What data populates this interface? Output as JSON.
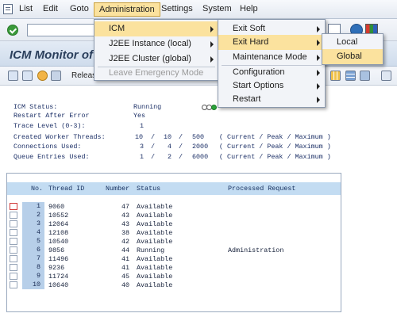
{
  "menubar": {
    "items": [
      "List",
      "Edit",
      "Goto",
      "Administration",
      "Settings",
      "System",
      "Help"
    ]
  },
  "page": {
    "title": "ICM Monitor of"
  },
  "app_toolbar": {
    "release_label": "Releas"
  },
  "status": {
    "icm_status_label": "ICM Status:",
    "icm_status_value": "Running",
    "restart_label": "Restart After Error",
    "restart_value": "Yes",
    "trace_label": "Trace Level (0-3):",
    "trace_value": "1",
    "worker_label": "Created Worker Threads:",
    "worker_current": "10",
    "worker_peak": "10",
    "worker_max": "500",
    "connections_label": "Connections Used:",
    "connections_current": "3",
    "connections_peak": "4",
    "connections_max": "2000",
    "queue_label": "Queue Entries Used:",
    "queue_current": "1",
    "queue_peak": "2",
    "queue_max": "6000",
    "legend": "( Current / Peak / Maximum )",
    "light_color": "#2aa33a"
  },
  "table": {
    "headers": {
      "no": "No.",
      "thread_id": "Thread ID",
      "number": "Number",
      "status": "Status",
      "processed": "Processed Request"
    },
    "rows": [
      {
        "no": "1",
        "thread_id": "9060",
        "number": "47",
        "status": "Available",
        "processed": ""
      },
      {
        "no": "2",
        "thread_id": "10552",
        "number": "43",
        "status": "Available",
        "processed": ""
      },
      {
        "no": "3",
        "thread_id": "12064",
        "number": "43",
        "status": "Available",
        "processed": ""
      },
      {
        "no": "4",
        "thread_id": "12108",
        "number": "38",
        "status": "Available",
        "processed": ""
      },
      {
        "no": "5",
        "thread_id": "10540",
        "number": "42",
        "status": "Available",
        "processed": ""
      },
      {
        "no": "6",
        "thread_id": "9856",
        "number": "44",
        "status": "Running",
        "processed": "Administration"
      },
      {
        "no": "7",
        "thread_id": "11496",
        "number": "41",
        "status": "Available",
        "processed": ""
      },
      {
        "no": "8",
        "thread_id": "9236",
        "number": "41",
        "status": "Available",
        "processed": ""
      },
      {
        "no": "9",
        "thread_id": "11724",
        "number": "45",
        "status": "Available",
        "processed": ""
      },
      {
        "no": "10",
        "thread_id": "10640",
        "number": "40",
        "status": "Available",
        "processed": ""
      }
    ]
  },
  "menus": {
    "administration": {
      "items": [
        "ICM",
        "J2EE Instance (local)",
        "J2EE Cluster (global)",
        "Leave Emergency Mode"
      ]
    },
    "icm": {
      "items": [
        "Exit Soft",
        "Exit Hard",
        "Maintenance Mode",
        "Configuration",
        "Start Options",
        "Restart"
      ]
    },
    "exit_hard": {
      "items": [
        "Local",
        "Global"
      ]
    }
  },
  "colors": {
    "menu_highlight": "#fbe29e",
    "table_header": "#c3dcf2",
    "row_number_bg": "#b7cfe9",
    "title_text": "#2b3f5c"
  }
}
